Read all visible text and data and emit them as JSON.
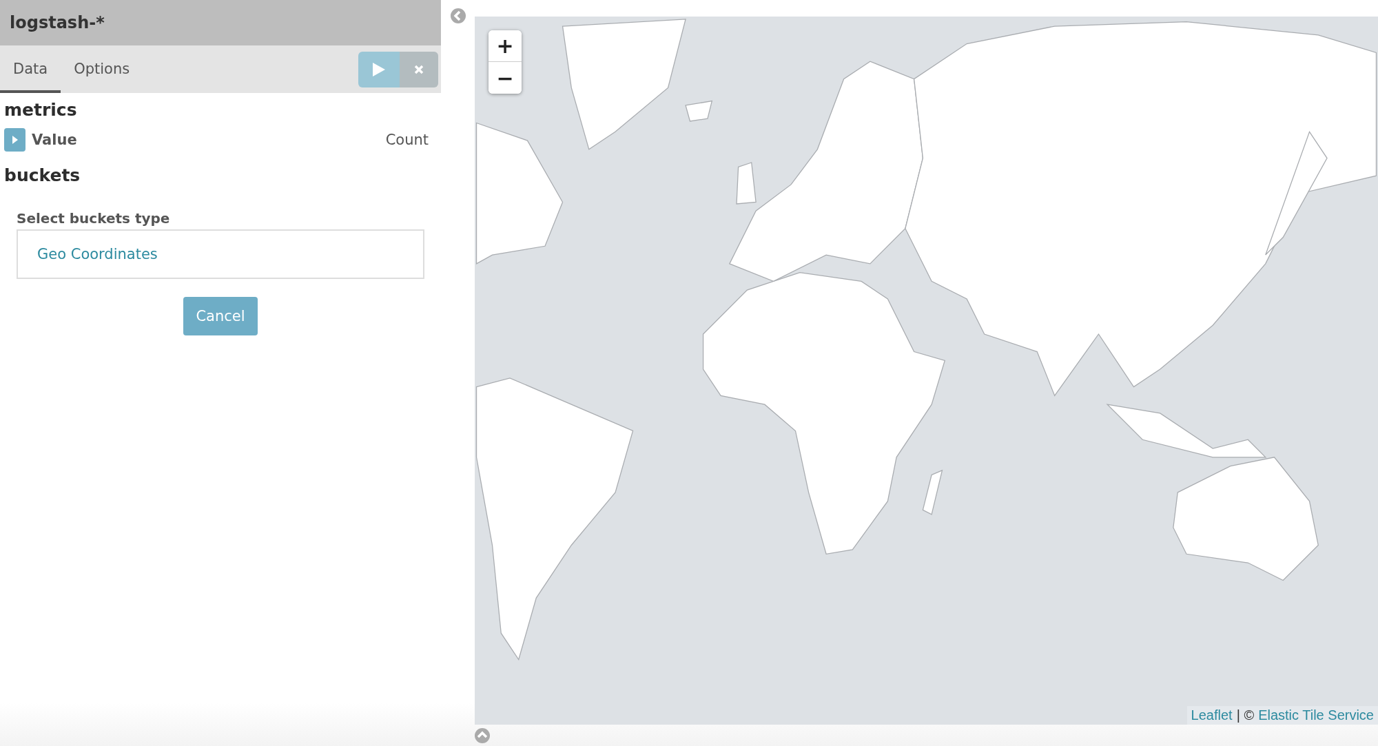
{
  "panel": {
    "title": "logstash-*",
    "tabs": [
      {
        "label": "Data",
        "selected": true
      },
      {
        "label": "Options",
        "selected": false
      }
    ],
    "metrics": {
      "title": "metrics",
      "items": [
        {
          "label": "Value",
          "value": "Count",
          "expanded": false
        }
      ]
    },
    "buckets": {
      "title": "buckets",
      "select_label": "Select buckets type",
      "options": [
        "Geo Coordinates"
      ],
      "cancel": "Cancel"
    }
  },
  "map": {
    "zoom_in": "+",
    "zoom_out": "−",
    "attribution": [
      {
        "kind": "link",
        "text": "Leaflet"
      },
      {
        "kind": "text",
        "text": "| ©"
      },
      {
        "kind": "link",
        "text": "Elastic Tile Service"
      }
    ]
  }
}
